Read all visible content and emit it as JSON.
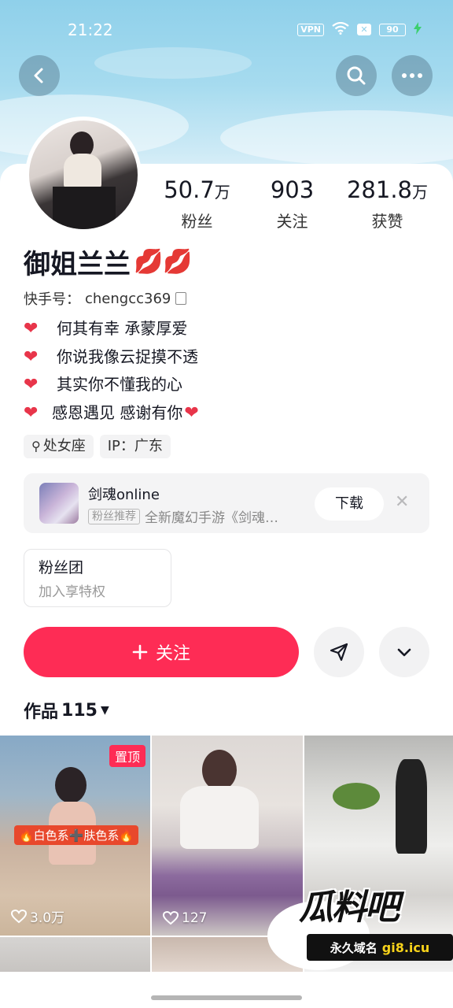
{
  "status_bar": {
    "time": "21:22",
    "vpn": "VPN",
    "battery": "90"
  },
  "nav": {
    "back_icon": "back-icon",
    "search_icon": "search-icon",
    "more_icon": "more-icon"
  },
  "profile": {
    "stats": [
      {
        "value": "50.7",
        "unit": "万",
        "label": "粉丝"
      },
      {
        "value": "903",
        "unit": "",
        "label": "关注"
      },
      {
        "value": "281.8",
        "unit": "万",
        "label": "获赞"
      }
    ],
    "name": "御姐兰兰",
    "name_emoji": "💋💋",
    "uid_label": "快手号：",
    "uid": "chengcc369",
    "bio": [
      "何其有幸 承蒙厚爱",
      "你说我像云捉摸不透",
      "其实你不懂我的心",
      "感恩遇见 感谢有你"
    ],
    "tags": [
      "处女座",
      "IP：广东"
    ]
  },
  "ad": {
    "title": "剑魂online",
    "badge": "粉丝推荐",
    "subtitle": "全新魔幻手游《剑魂…",
    "button": "下载"
  },
  "fan_club": {
    "title": "粉丝团",
    "subtitle": "加入享特权"
  },
  "actions": {
    "follow": "关注"
  },
  "works": {
    "label": "作品",
    "count": "115",
    "items": [
      {
        "pinned": "置顶",
        "overlay": "🔥白色系➕肤色系🔥",
        "likes": "3.0万"
      },
      {
        "likes": "127"
      },
      {
        "likes": ""
      }
    ]
  },
  "watermark": {
    "logo": "瓜料吧",
    "caption": "永久域名",
    "domain": "gi8.icu"
  },
  "colors": {
    "accent": "#fe2c55",
    "heart": "#e8354a"
  }
}
